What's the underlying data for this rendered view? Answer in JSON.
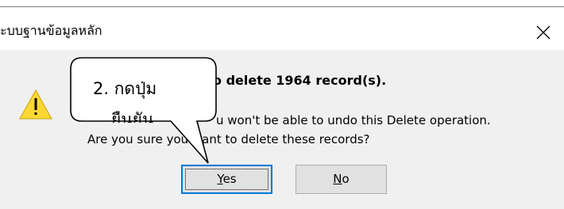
{
  "window": {
    "title": "ะบบฐานข้อมูลหลัก",
    "close_label": "Close"
  },
  "dialog": {
    "heading": "o delete 1964 record(s).",
    "message_line1": "u won't be able to undo this Delete operation.",
    "message_line2": "Are you sure you want to delete these records?",
    "icon": "warning-icon"
  },
  "buttons": {
    "yes": {
      "mnemonic": "Y",
      "rest": "es"
    },
    "no": {
      "mnemonic": "N",
      "rest": "o"
    }
  },
  "callout": {
    "line1": "2. กดปุ่ม",
    "line2": "ยืนยัน"
  },
  "colors": {
    "dialog_bg": "#f0f0f0",
    "warning_fill": "#fdd835",
    "focus_border": "#0078d7"
  }
}
